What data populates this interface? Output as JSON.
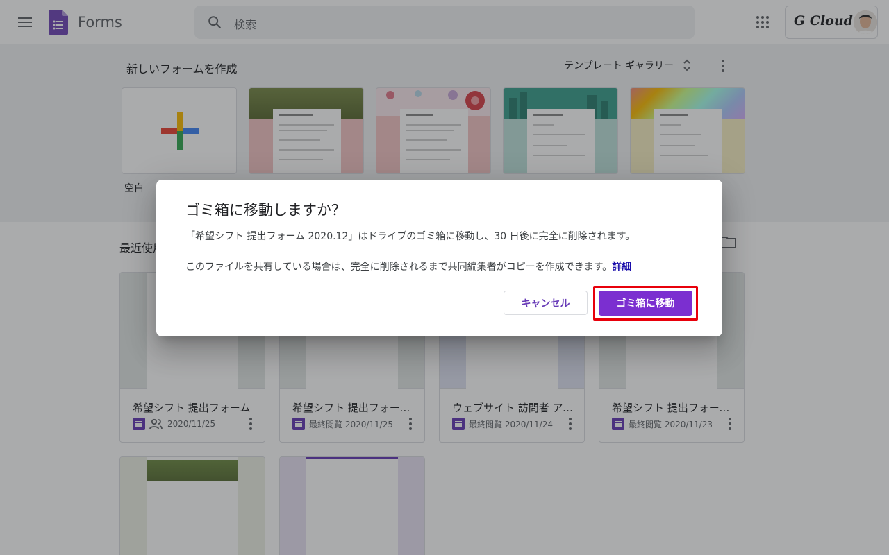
{
  "app": {
    "name": "Forms",
    "brand_color": "#673ab7"
  },
  "search": {
    "placeholder": "検索"
  },
  "account": {
    "logo_text": "G Cloud"
  },
  "templates": {
    "title": "新しいフォームを作成",
    "gallery_label": "テンプレート ギャラリー",
    "items": [
      {
        "label": "空白",
        "thumb": "blank-plus"
      },
      {
        "label": "",
        "thumb": "event-survey",
        "color": "#f4c6c6"
      },
      {
        "label": "",
        "thumb": "order-form",
        "color": "#f4c6c6"
      },
      {
        "label": "",
        "thumb": "job-application",
        "color": "#bfe3db"
      },
      {
        "label": "",
        "thumb": "party-invite",
        "color": "#f7efc3"
      }
    ]
  },
  "recent": {
    "title": "最近使用",
    "docs": [
      {
        "name": "希望シフト 提出フォーム",
        "meta": "2020/11/25",
        "shared": true
      },
      {
        "name": "希望シフト 提出フォーム 2...",
        "meta": "最終閲覧 2020/11/25",
        "shared": false
      },
      {
        "name": "ウェブサイト 訪問者 アン...",
        "meta": "最終閲覧 2020/11/24",
        "shared": false
      },
      {
        "name": "希望シフト 提出フォーム 2...",
        "meta": "最終閲覧 2020/11/23",
        "shared": false
      },
      {
        "name": "",
        "meta": "",
        "shared": false
      },
      {
        "name": "",
        "meta": "",
        "shared": false
      }
    ]
  },
  "dialog": {
    "title": "ゴミ箱に移動しますか？",
    "body1": "「希望シフト 提出フォーム 2020.12」はドライブのゴミ箱に移動し、30 日後に完全に削除されます。",
    "body2": "このファイルを共有している場合は、完全に削除されるまで共同編集者がコピーを作成できます。",
    "link": "詳細",
    "cancel_label": "キャンセル",
    "confirm_label": "ゴミ箱に移動",
    "confirm_color": "#7b2fd0",
    "highlight_color": "#e8000b"
  }
}
